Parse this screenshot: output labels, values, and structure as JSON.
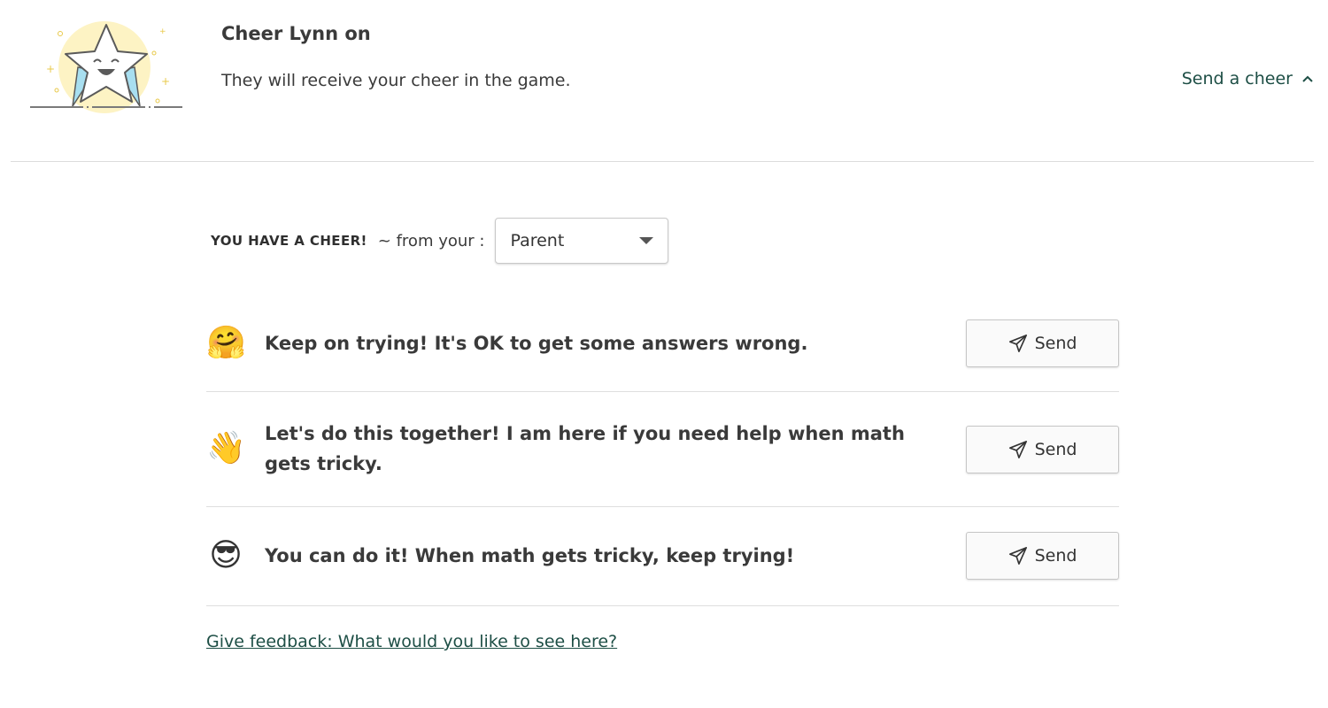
{
  "header": {
    "title": "Cheer Lynn on",
    "subtitle": "They will receive your cheer in the game.",
    "toggle_label": "Send a cheer",
    "toggle_icon": "chevron-up-icon",
    "illustration": "smiling-star-illustration"
  },
  "from": {
    "label": "YOU HAVE A CHEER!",
    "text": "~ from your :",
    "selected": "Parent",
    "dropdown_icon": "caret-down-icon"
  },
  "cheers": [
    {
      "emoji": "🤗",
      "emoji_name": "hugging-face-emoji",
      "text": "Keep on trying! It's OK to get some answers wrong.",
      "button": "Send"
    },
    {
      "emoji": "👋",
      "emoji_name": "waving-hand-emoji",
      "text": "Let's do this together! I am here if you need help when math gets tricky.",
      "button": "Send"
    },
    {
      "emoji": "😎",
      "emoji_name": "sunglasses-face-emoji",
      "text": "You can do it! When math gets tricky, keep trying!",
      "button": "Send"
    }
  ],
  "send_icon": "paper-plane-icon",
  "feedback_link": "Give feedback: What would you like to see here?",
  "colors": {
    "link_green": "#1d4e45",
    "text": "#3a3a3a",
    "divider": "#dcdcdc",
    "illustration_yellow": "#fdf3c4",
    "illustration_blue": "#a8dff0"
  }
}
